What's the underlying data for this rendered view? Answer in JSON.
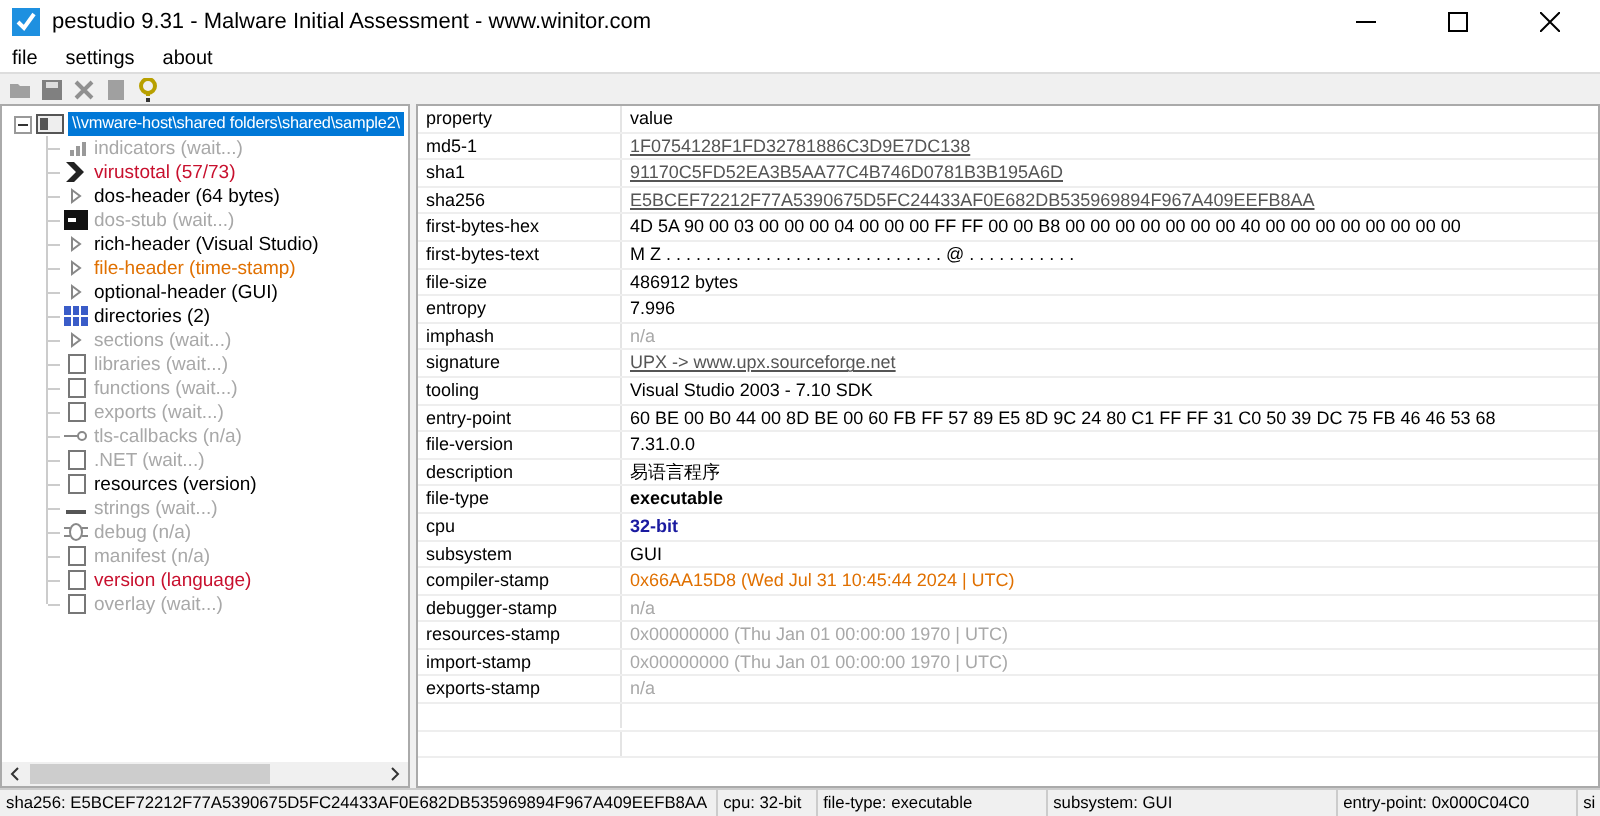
{
  "window": {
    "title": "pestudio 9.31 - Malware Initial Assessment - www.winitor.com"
  },
  "menu": [
    "file",
    "settings",
    "about"
  ],
  "tree": {
    "root": {
      "label": "\\\\vmware-host\\shared folders\\shared\\sample2\\",
      "selected": true
    },
    "children": [
      {
        "label": "indicators (wait...)",
        "color": "#a8a8a8",
        "kind": "bars"
      },
      {
        "label": "virustotal (57/73)",
        "color": "#c8102e",
        "kind": "arrow"
      },
      {
        "label": "dos-header (64 bytes)",
        "color": "#000000",
        "kind": "caret"
      },
      {
        "label": "dos-stub (wait...)",
        "color": "#a8a8a8",
        "kind": "console"
      },
      {
        "label": "rich-header (Visual Studio)",
        "color": "#000000",
        "kind": "caret"
      },
      {
        "label": "file-header (time-stamp)",
        "color": "#e07000",
        "kind": "caret"
      },
      {
        "label": "optional-header (GUI)",
        "color": "#000000",
        "kind": "caret"
      },
      {
        "label": "directories (2)",
        "color": "#000000",
        "kind": "grid"
      },
      {
        "label": "sections (wait...)",
        "color": "#a8a8a8",
        "kind": "caret"
      },
      {
        "label": "libraries (wait...)",
        "color": "#a8a8a8",
        "kind": "doc"
      },
      {
        "label": "functions (wait...)",
        "color": "#a8a8a8",
        "kind": "doc"
      },
      {
        "label": "exports (wait...)",
        "color": "#a8a8a8",
        "kind": "doc"
      },
      {
        "label": "tls-callbacks (n/a)",
        "color": "#a8a8a8",
        "kind": "key"
      },
      {
        "label": ".NET (wait...)",
        "color": "#a8a8a8",
        "kind": "doc"
      },
      {
        "label": "resources (version)",
        "color": "#000000",
        "kind": "doc"
      },
      {
        "label": "strings (wait...)",
        "color": "#a8a8a8",
        "kind": "abc"
      },
      {
        "label": "debug (n/a)",
        "color": "#a8a8a8",
        "kind": "bug"
      },
      {
        "label": "manifest (n/a)",
        "color": "#a8a8a8",
        "kind": "doc"
      },
      {
        "label": "version (language)",
        "color": "#c8102e",
        "kind": "doc"
      },
      {
        "label": "overlay (wait...)",
        "color": "#a8a8a8",
        "kind": "doc"
      }
    ]
  },
  "table": {
    "columns": [
      "property",
      "value"
    ],
    "rows": [
      {
        "property": "md5-1",
        "value": "1F0754128F1FD32781886C3D9E7DC138",
        "kind": "link"
      },
      {
        "property": "sha1",
        "value": "91170C5FD52EA3B5AA77C4B746D0781B3B195A6D",
        "kind": "link"
      },
      {
        "property": "sha256",
        "value": "E5BCEF72212F77A5390675D5FC24433AF0E682DB535969894F967A409EEFB8AA",
        "kind": "link"
      },
      {
        "property": "first-bytes-hex",
        "value": "4D 5A 90 00 03 00 00 00 04 00 00 00 FF FF 00 00 B8 00 00 00 00 00 00 00 40 00 00 00 00 00 00 00 00",
        "kind": "plain"
      },
      {
        "property": "first-bytes-text",
        "value": "M Z . . . . . . . . . . . . . . . . . . . . . . . . . . . . @ . . . . . . . . . . .",
        "kind": "plain"
      },
      {
        "property": "file-size",
        "value": "486912 bytes",
        "kind": "plain"
      },
      {
        "property": "entropy",
        "value": "7.996",
        "kind": "plain"
      },
      {
        "property": "imphash",
        "value": "n/a",
        "kind": "muted"
      },
      {
        "property": "signature",
        "value": "UPX -> www.upx.sourceforge.net",
        "kind": "link"
      },
      {
        "property": "tooling",
        "value": "Visual Studio 2003 - 7.10 SDK",
        "kind": "plain"
      },
      {
        "property": "entry-point",
        "value": "60 BE 00 B0 44 00 8D BE 00 60 FB FF 57 89 E5 8D 9C 24 80 C1 FF FF 31 C0 50 39 DC 75 FB 46 46 53 68",
        "kind": "plain"
      },
      {
        "property": "file-version",
        "value": "7.31.0.0",
        "kind": "plain"
      },
      {
        "property": "description",
        "value": "易语言程序",
        "kind": "plain"
      },
      {
        "property": "file-type",
        "value": "executable",
        "kind": "bold"
      },
      {
        "property": "cpu",
        "value": "32-bit",
        "kind": "blue"
      },
      {
        "property": "subsystem",
        "value": "GUI",
        "kind": "plain"
      },
      {
        "property": "compiler-stamp",
        "value": "0x66AA15D8 (Wed Jul 31 10:45:44 2024 | UTC)",
        "kind": "warning"
      },
      {
        "property": "debugger-stamp",
        "value": "n/a",
        "kind": "muted"
      },
      {
        "property": "resources-stamp",
        "value": "0x00000000 (Thu Jan 01 00:00:00 1970 | UTC)",
        "kind": "muted"
      },
      {
        "property": "import-stamp",
        "value": "0x00000000 (Thu Jan 01 00:00:00 1970 | UTC)",
        "kind": "muted"
      },
      {
        "property": "exports-stamp",
        "value": "n/a",
        "kind": "muted"
      }
    ]
  },
  "status_bar": [
    "sha256: E5BCEF72212F77A5390675D5FC24433AF0E682DB535969894F967A409EEFB8AA",
    "cpu: 32-bit",
    "file-type: executable",
    "subsystem: GUI",
    "entry-point: 0x000C04C0",
    "si"
  ]
}
